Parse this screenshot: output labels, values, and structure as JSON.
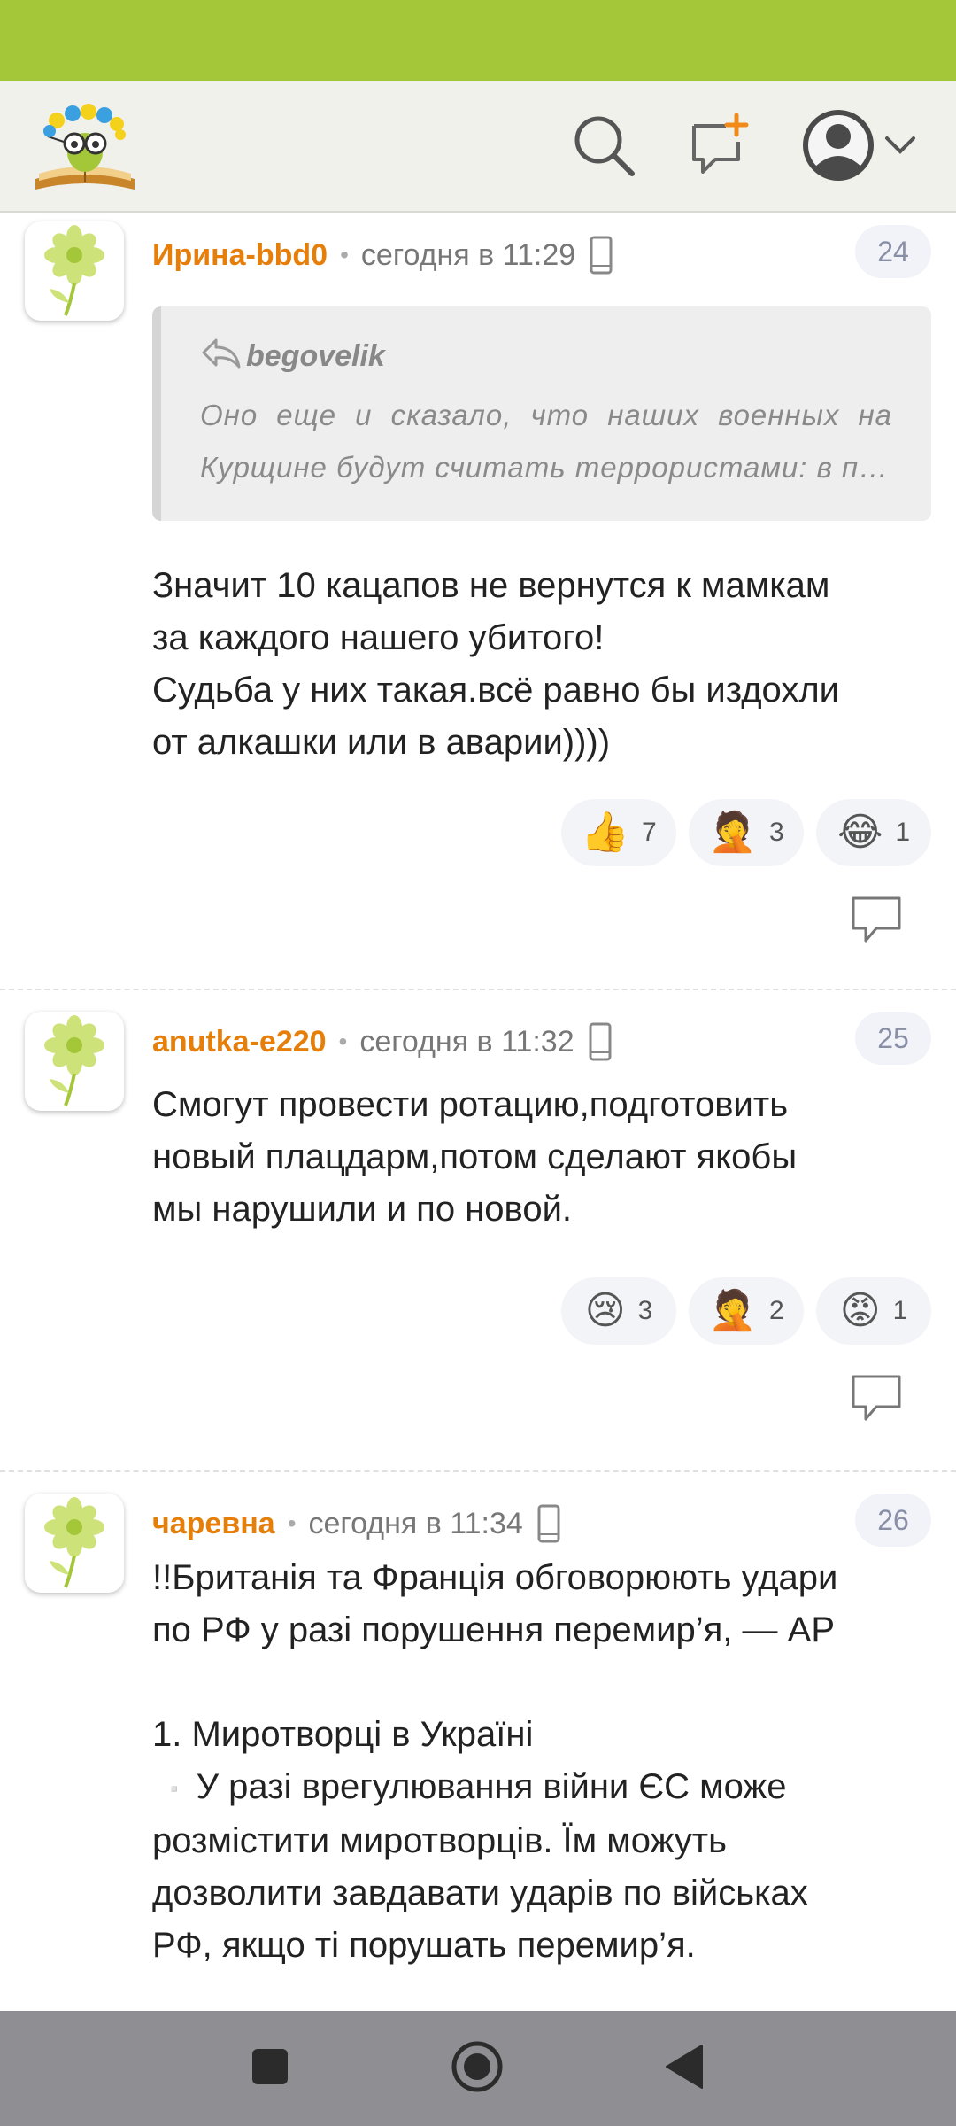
{
  "header": {
    "logo_alt": "site-logo",
    "icons": [
      "search-icon",
      "new-post-icon",
      "user-avatar-icon",
      "chevron-down-icon"
    ]
  },
  "comments": [
    {
      "author": "Ирина-bbd0",
      "time": "сегодня в 11:29",
      "number": "24",
      "quote": {
        "author": "begovelik",
        "line1": "Оно еще и сказало, что наших военных на",
        "line2": "Курщине будут считать террористами: в пл..."
      },
      "text": "Значит 10 кацапов не вернутся к мамкам\nза каждого нашего убитого!\nСудьба у них такая.всё равно бы издохли\nот алкашки или в аварии))))",
      "reactions": [
        {
          "emoji": "👍",
          "count": "7"
        },
        {
          "emoji": "🤦",
          "count": "3"
        },
        {
          "emoji": "😂",
          "count": "1"
        }
      ]
    },
    {
      "author": "anutka-e220",
      "time": "сегодня в 11:32",
      "number": "25",
      "text": "Смогут провести ротацию,подготовить\nновый плацдарм,потом сделают якобы\nмы нарушили и по новой.",
      "reactions": [
        {
          "emoji": "😢",
          "count": "3"
        },
        {
          "emoji": "🤦",
          "count": "2"
        },
        {
          "emoji": "😡",
          "count": "1"
        }
      ]
    },
    {
      "author": "чаревна",
      "time": "сегодня в 11:34",
      "number": "26",
      "text_line1": "!!Британія та Франція обговорюють удари",
      "text_line2": "по РФ у разі порушення перемир’я, — AP",
      "text_line3": "1. Миротворці в Україні",
      "bullet": "▫️",
      "text_line4": "У разі врегулювання війни ЄС може",
      "text_line5": "розмістити миротворців. Їм можуть",
      "text_line6": "дозволити завдавати ударів по військах",
      "text_line7": "РФ, якщо ті порушать перемир’я."
    }
  ],
  "colors": {
    "status_bar": "#a4c639",
    "author": "#e67e0a",
    "nav_bar": "#8e8e93"
  }
}
